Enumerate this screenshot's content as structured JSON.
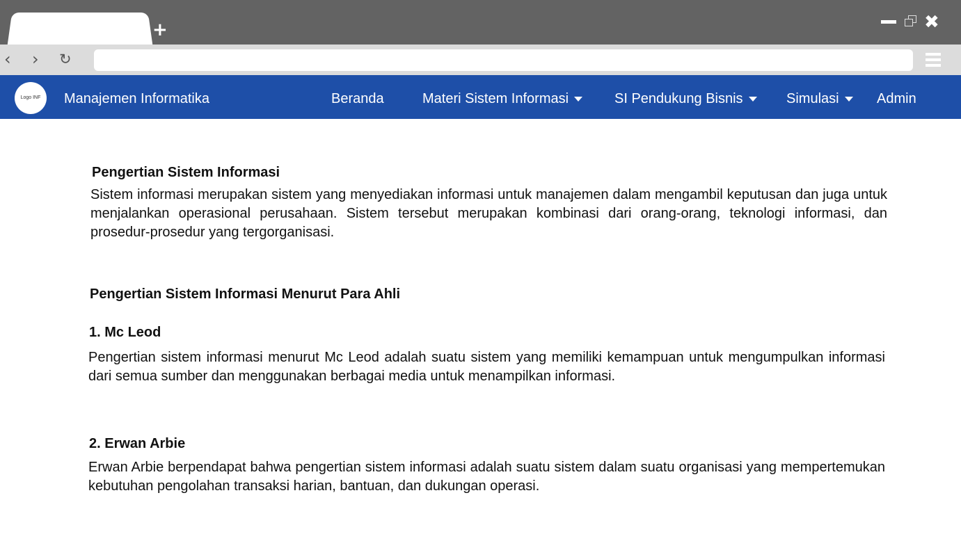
{
  "browser": {
    "new_tab_label": "+",
    "close_label": "✖",
    "back_label": "‹",
    "forward_label": "›",
    "reload_label": "↻",
    "url_value": ""
  },
  "site": {
    "logo_text": "Logo INF",
    "brand": "Manajemen Informatika",
    "nav": {
      "beranda": "Beranda",
      "materi": "Materi Sistem Informasi",
      "pendukung": "SI Pendukung Bisnis",
      "simulasi": "Simulasi",
      "admin": "Admin"
    },
    "nav_color": "#1e4fa8"
  },
  "content": {
    "section1_title": "Pengertian Sistem Informasi",
    "section1_body": "Sistem informasi merupakan sistem yang menyediakan informasi untuk manajemen dalam mengambil keputusan dan juga untuk menjalankan operasional perusahaan. Sistem tersebut merupakan kombinasi dari orang-orang, teknologi informasi, dan prosedur-prosedur yang tergorganisasi.",
    "section2_title": "Pengertian Sistem Informasi Menurut Para Ahli",
    "expert1_title": "1. Mc Leod",
    "expert1_body": "Pengertian sistem informasi menurut Mc Leod adalah suatu sistem yang memiliki kemampuan untuk mengumpulkan informasi dari semua sumber dan menggunakan berbagai media untuk menampilkan informasi.",
    "expert2_title": "2. Erwan Arbie",
    "expert2_body": "Erwan Arbie berpendapat bahwa pengertian sistem informasi adalah suatu sistem dalam suatu organisasi yang mempertemukan kebutuhan pengolahan transaksi harian, bantuan, dan dukungan operasi."
  }
}
